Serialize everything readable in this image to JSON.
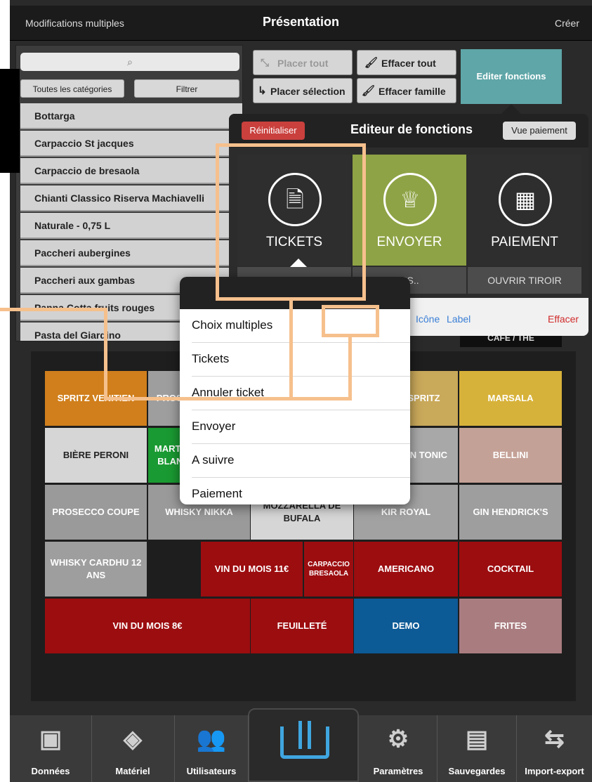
{
  "topbar": {
    "left": "Modifications multiples",
    "title": "Présentation",
    "right": "Créer"
  },
  "search": {
    "icon": "search-icon"
  },
  "categories": {
    "all": "Toutes les catégories",
    "filter": "Filtrer"
  },
  "list": [
    "Bottarga",
    "Carpaccio St jacques",
    "Carpaccio de bresaola",
    "Chianti Classico Riserva Machiavelli",
    "Naturale - 0,75 L",
    "Paccheri aubergines",
    "Paccheri aux gambas",
    "Panna Cotta fruits rouges",
    "Pasta del Giardino"
  ],
  "actions": {
    "place_all": "Placer tout",
    "clear_all": "Effacer tout",
    "place_selection": "Placer sélection",
    "clear_family": "Effacer famille",
    "edit_functions": "Editer fonctions"
  },
  "fn_editor": {
    "reset": "Réinitialiser",
    "title": "Editeur de fonctions",
    "pay_view": "Vue paiement",
    "tiles": [
      {
        "label": "TICKETS",
        "icon": "ticket-icon",
        "color": "#2e2e2e"
      },
      {
        "label": "ENVOYER",
        "icon": "chef-hat-icon",
        "color": "#8ea345"
      },
      {
        "label": "PAIEMENT",
        "icon": "calculator-icon",
        "color": "#2e2e2e"
      }
    ],
    "subtiles": [
      "",
      "US..",
      "OUVRIR TIROIR"
    ],
    "links": {
      "color": "ur",
      "icon": "Icône",
      "label": "Label",
      "delete": "Effacer"
    }
  },
  "dropdown": {
    "items": [
      "Choix multiples",
      "Tickets",
      "Annuler ticket",
      "Envoyer",
      "A suivre",
      "Paiement"
    ]
  },
  "grid_peek": "CAFE / THE",
  "grid": [
    {
      "label": "SPRITZ VENITIEN",
      "color": "#d07f1c"
    },
    {
      "label": "PROSECCO",
      "color": "#9e9e9e"
    },
    {
      "label": "",
      "color": "#9e9e9e"
    },
    {
      "label": "",
      "color": "#c9a95a"
    },
    {
      "label": "SPRITZ",
      "color": "#c9a95a"
    },
    {
      "label": "MARSALA",
      "color": "#d7b23a"
    },
    {
      "label": "BIÈRE PERONI",
      "color": "#d6d6d6",
      "dark": true
    },
    {
      "label": "MARTINI BLANC",
      "color": "#1a9a32"
    },
    {
      "label": "",
      "color": "#9e9e9e"
    },
    {
      "label": "",
      "color": "#c9a4a0"
    },
    {
      "label": "GIN TONIC",
      "color": "#a8a8a8"
    },
    {
      "label": "BELLINI",
      "color": "#c4a196"
    },
    {
      "label": "PROSECCO COUPE",
      "color": "#9a9a9a"
    },
    {
      "label": "WHISKY NIKKA",
      "color": "#9a9a9a"
    },
    {
      "label": "MOZZARELLA DE BUFALA",
      "color": "#d6d6d6",
      "dark": true
    },
    {
      "label": "KIR ROYAL",
      "color": "#a2a2a2"
    },
    {
      "label": "GIN HENDRICK'S",
      "color": "#9e9e9e"
    },
    {
      "label": "WHISKY CARDHU 12 ANS",
      "color": "#9e9e9e"
    },
    {
      "label": "VIN DU MOIS 11€",
      "color": "#9c0d10"
    },
    {
      "label": "CARPACCIO BRESAOLA",
      "color": "#9c0d10"
    },
    {
      "label": "AMERICANO",
      "color": "#9c0d10"
    },
    {
      "label": "COCKTAIL",
      "color": "#9c0d10"
    },
    {
      "label": "VIN DU MOIS 8€",
      "color": "#9c0d10"
    },
    {
      "label": "FEUILLETÉ",
      "color": "#9c0d10"
    },
    {
      "label": "DEMO",
      "color": "#0c5a96"
    },
    {
      "label": "FRITES",
      "color": "#a97c80"
    }
  ],
  "toolbar": [
    {
      "label": "Données",
      "icon": "box-icon"
    },
    {
      "label": "Matériel",
      "icon": "device-icon"
    },
    {
      "label": "Utilisateurs",
      "icon": "users-icon"
    },
    {
      "label": "",
      "icon": "power-icon"
    },
    {
      "label": "Paramètres",
      "icon": "gear-icon"
    },
    {
      "label": "Sauvegardes",
      "icon": "database-icon"
    },
    {
      "label": "Import-export",
      "icon": "transfer-icon"
    }
  ],
  "colors": {
    "accent": "#5fa6a8",
    "annotation": "#f6c08d",
    "danger": "#c9403d"
  }
}
